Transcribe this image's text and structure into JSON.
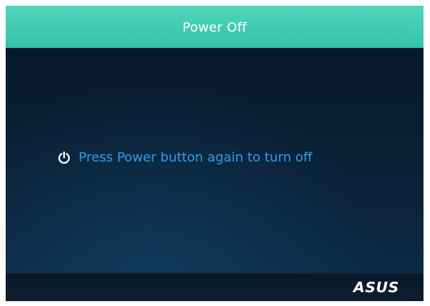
{
  "window": {
    "title": "Power Off"
  },
  "message": {
    "icon": "power-icon",
    "text": "Press Power button again to turn off"
  },
  "footer": {
    "logo_text": "ASUS"
  },
  "colors": {
    "titlebar": "#3fcfb3",
    "background": "#0b1f33",
    "message_text": "#2f9ee8",
    "icon": "#ffffff"
  }
}
